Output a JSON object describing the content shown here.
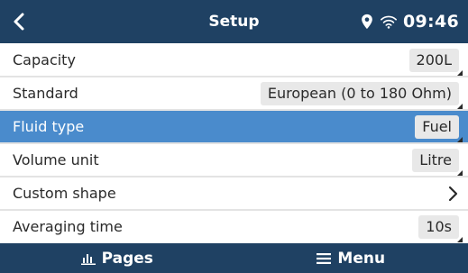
{
  "topbar": {
    "title": "Setup",
    "back_icon": "chevron-left-icon",
    "location_icon": "location-pin-icon",
    "wifi_icon": "wifi-icon",
    "time": "09:46"
  },
  "settings": [
    {
      "label": "Capacity",
      "value": "200L",
      "type": "button",
      "corner": true
    },
    {
      "label": "Standard",
      "value": "European (0 to 180 Ohm)",
      "type": "button",
      "corner": true
    },
    {
      "label": "Fluid type",
      "value": "Fuel",
      "type": "button",
      "corner": true,
      "selected": true
    },
    {
      "label": "Volume unit",
      "value": "Litre",
      "type": "button",
      "corner": true
    },
    {
      "label": "Custom shape",
      "value": "",
      "type": "link",
      "icon": "chevron-right-icon"
    },
    {
      "label": "Averaging time",
      "value": "10s",
      "type": "button",
      "corner": true
    }
  ],
  "bottombar": {
    "pages_label": "Pages",
    "pages_icon": "bar-chart-icon",
    "menu_label": "Menu",
    "menu_icon": "hamburger-menu-icon"
  },
  "colors": {
    "header_bg": "#1f4163",
    "selected_row_bg": "#4a8bcc",
    "value_bg": "#e8e8e8",
    "row_divider": "#e3e3e3"
  }
}
